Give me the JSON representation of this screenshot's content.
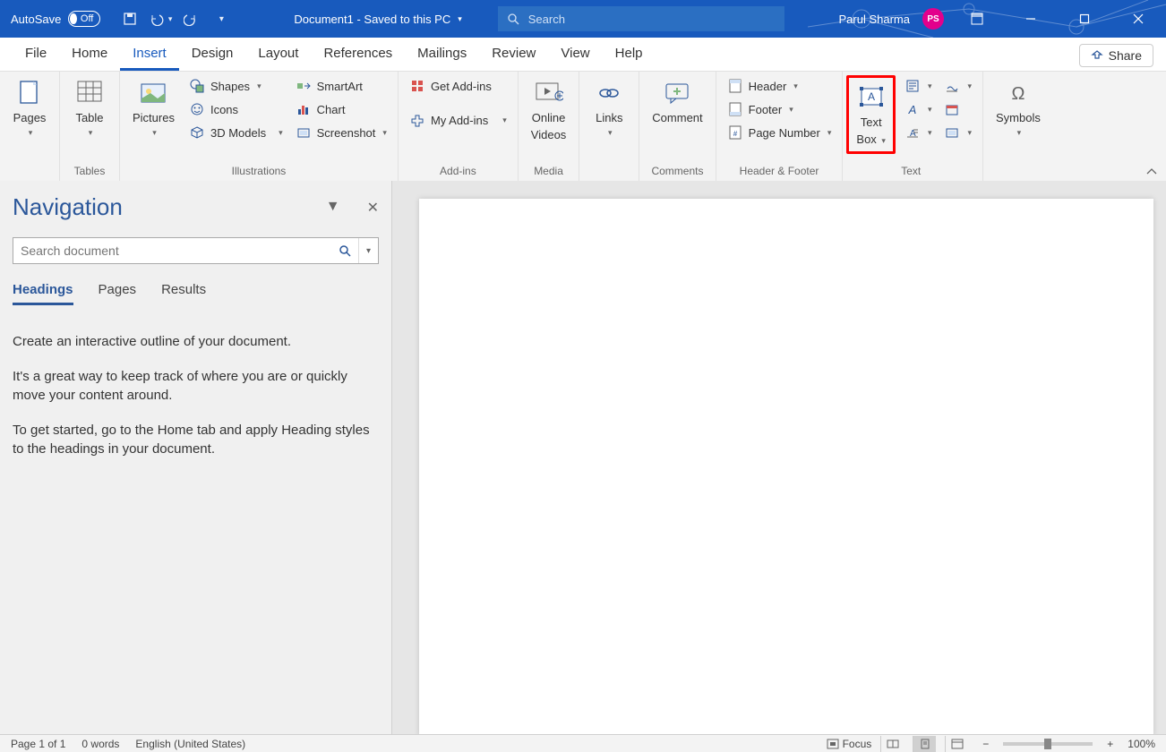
{
  "title_bar": {
    "autosave_label": "AutoSave",
    "autosave_state": "Off",
    "doc_title": "Document1 - Saved to this PC",
    "search_placeholder": "Search",
    "user_name": "Parul Sharma",
    "user_initials": "PS"
  },
  "tabs": [
    "File",
    "Home",
    "Insert",
    "Design",
    "Layout",
    "References",
    "Mailings",
    "Review",
    "View",
    "Help"
  ],
  "active_tab": "Insert",
  "share_label": "Share",
  "ribbon": {
    "pages": {
      "label": "Pages",
      "group": ""
    },
    "tables": {
      "table": "Table",
      "group": "Tables"
    },
    "illustrations": {
      "pictures": "Pictures",
      "shapes": "Shapes",
      "icons": "Icons",
      "models": "3D Models",
      "smartart": "SmartArt",
      "chart": "Chart",
      "screenshot": "Screenshot",
      "group": "Illustrations"
    },
    "addins": {
      "get": "Get Add-ins",
      "my": "My Add-ins",
      "group": "Add-ins"
    },
    "media": {
      "online_videos": "Online Videos",
      "group": "Media"
    },
    "links": {
      "links": "Links",
      "group": ""
    },
    "comments": {
      "comment": "Comment",
      "group": "Comments"
    },
    "header_footer": {
      "header": "Header",
      "footer": "Footer",
      "page_number": "Page Number",
      "group": "Header & Footer"
    },
    "text": {
      "text_box": "Text Box",
      "group": "Text"
    },
    "symbols": {
      "symbols": "Symbols",
      "group": ""
    }
  },
  "navigation": {
    "title": "Navigation",
    "search_placeholder": "Search document",
    "tabs": [
      "Headings",
      "Pages",
      "Results"
    ],
    "active_tab": "Headings",
    "body": [
      "Create an interactive outline of your document.",
      "It's a great way to keep track of where you are or quickly move your content around.",
      "To get started, go to the Home tab and apply Heading styles to the headings in your document."
    ]
  },
  "status": {
    "page": "Page 1 of 1",
    "words": "0 words",
    "language": "English (United States)",
    "focus": "Focus",
    "zoom": "100%"
  }
}
